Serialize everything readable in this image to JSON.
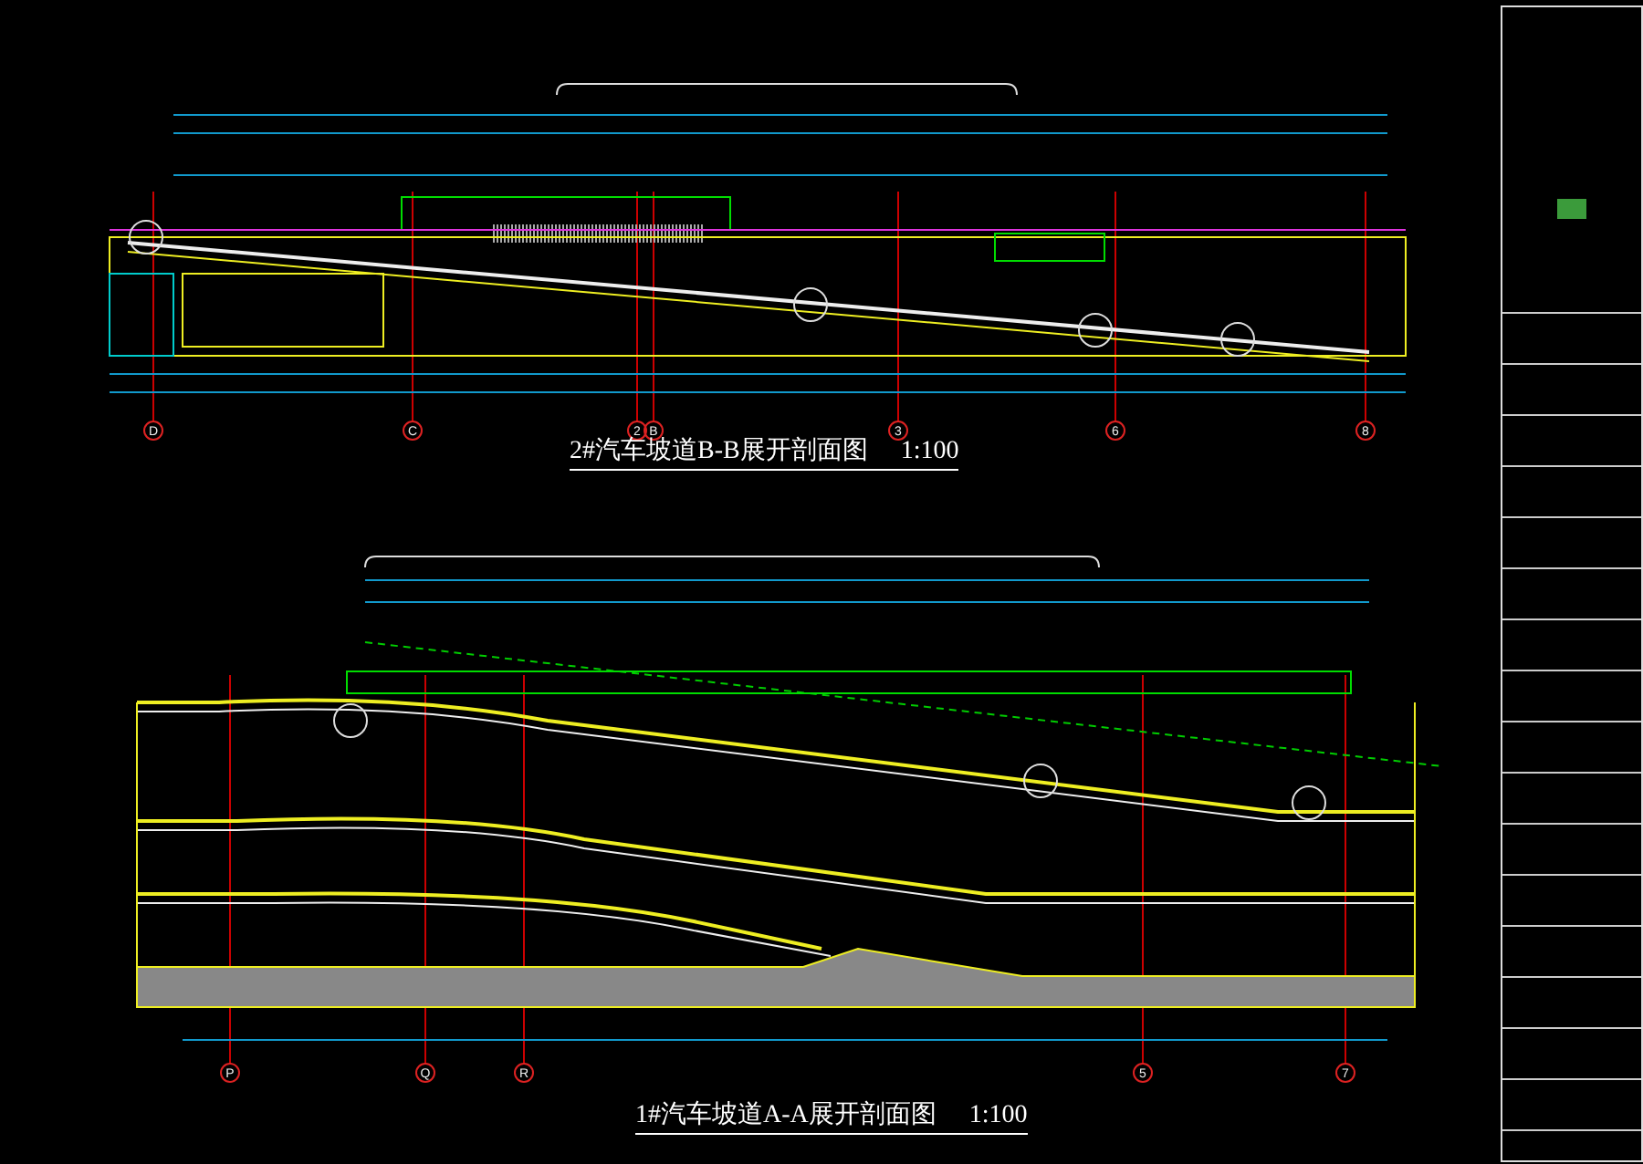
{
  "sections": [
    {
      "title": "2#汽车坡道B-B展开剖面图",
      "scale": "1:100",
      "grid_axes": [
        "D",
        "C",
        "2",
        "B",
        "3",
        "6",
        "8"
      ]
    },
    {
      "title": "1#汽车坡道A-A展开剖面图",
      "scale": "1:100",
      "grid_axes": [
        "P",
        "Q",
        "R",
        "5",
        "7"
      ]
    }
  ]
}
